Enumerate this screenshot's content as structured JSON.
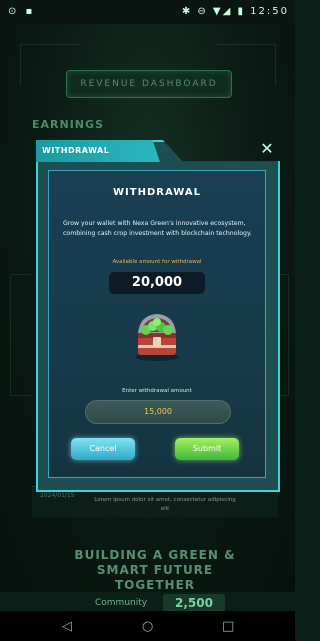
{
  "status": {
    "left": "⊙ ▪",
    "right": "✱ ⊖ ▼◢ ▮ 12:50"
  },
  "background": {
    "revenue_button": "REVENUE DASHBOARD",
    "earnings_label": "EARNINGS",
    "row_date": "2024/01/15",
    "row_text": "Lorem ipsum dolor sit amet, consectetur adipiscing elit",
    "slogan": "BUILDING A GREEN & SMART FUTURE TOGETHER",
    "community_label": "Community",
    "community_value": "2,500"
  },
  "modal": {
    "tab_label": "WITHDRAWAL",
    "title": "WITHDRAWAL",
    "description": "Grow your wallet with Nexa Green's innovative ecosystem, combining cash crop investment with blockchain technology.",
    "available_label": "Available amount for withdrawal",
    "available_amount": "20,000",
    "enter_label": "Enter withdrawal amount",
    "input_value": "15,000",
    "cancel_label": "Cancel",
    "submit_label": "Submit",
    "close_icon": "close-icon"
  },
  "navbar": {
    "back": "◁",
    "home": "○",
    "recent": "□"
  },
  "colors": {
    "accent": "#45d0d7",
    "amount": "#f4c45a",
    "cancel": "#2ea9c9",
    "submit": "#3fb83a"
  }
}
